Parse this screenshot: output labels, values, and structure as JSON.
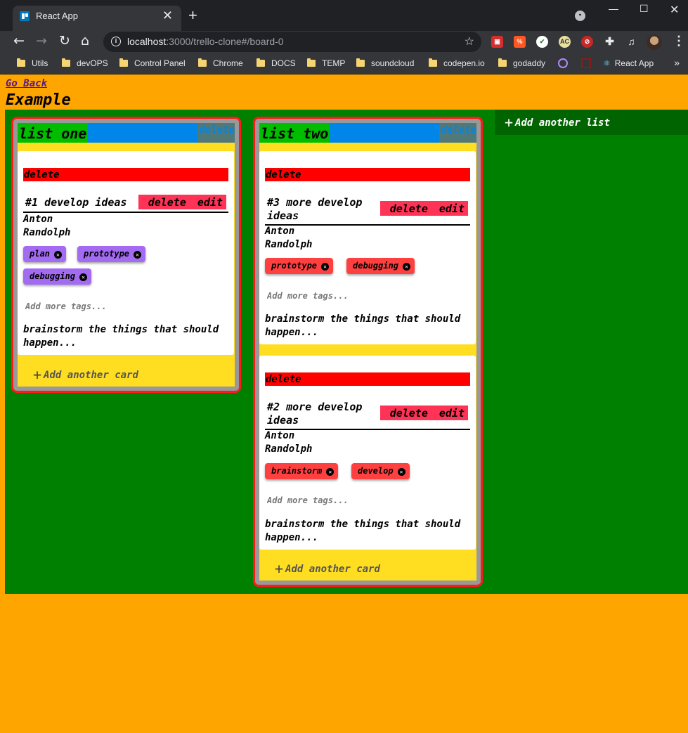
{
  "browser": {
    "tab_title": "React App",
    "tab_close": "✕",
    "new_tab": "+",
    "url_host": "localhost",
    "url_path": ":3000/trello-clone#/board-0",
    "bookmarks": [
      "Utils",
      "devOPS",
      "Control Panel",
      "Chrome",
      "DOCS",
      "TEMP",
      "soundcloud",
      "codepen.io",
      "godaddy",
      "React App"
    ],
    "bookmarks_more": "»",
    "extensions": [
      "shield-ext-icon",
      "code-ext-icon",
      "color-ext-icon",
      "ac-ext-icon",
      "blocker-ext-icon",
      "puzzle-icon",
      "media-icon"
    ],
    "ext_ac_label": "AC"
  },
  "app": {
    "go_back": "Go Back",
    "board_title": "Example",
    "add_list_label": "Add another list",
    "add_card_label": "Add another card",
    "tag_placeholder": "Add more tags...",
    "colors": {
      "background": "#ffa500",
      "board": "#008000",
      "list_border": "#ff1a1a",
      "list_body": "#ffde21",
      "card_delete": "#ff0000",
      "card_actions": "#ff3355",
      "tag_purple": "#a36bf2",
      "tag_red": "#ff4040"
    },
    "lists": [
      {
        "title": "list one",
        "delete_label": "delete",
        "cards": [
          {
            "delete_label": "delete",
            "name_line1": "#1 develop ideas",
            "name_line2": "",
            "actions_delete": "delete",
            "actions_edit": "edit",
            "owner_line1": "Anton",
            "owner_line2": "Randolph",
            "tags": [
              "plan",
              "prototype",
              "debugging"
            ],
            "description_line1": "brainstorm the things that should",
            "description_line2": "happen..."
          }
        ]
      },
      {
        "title": "list two",
        "delete_label": "delete",
        "cards": [
          {
            "delete_label": "delete",
            "name_line1": "#3 more develop",
            "name_line2": "ideas",
            "actions_delete": "delete",
            "actions_edit": "edit",
            "owner_line1": "Anton",
            "owner_line2": "Randolph",
            "tags": [
              "prototype",
              "debugging"
            ],
            "description_line1": "brainstorm the things that should",
            "description_line2": "happen..."
          },
          {
            "delete_label": "delete",
            "name_line1": "#2 more develop",
            "name_line2": "ideas",
            "actions_delete": "delete",
            "actions_edit": "edit",
            "owner_line1": "Anton",
            "owner_line2": "Randolph",
            "tags": [
              "brainstorm",
              "develop"
            ],
            "description_line1": "brainstorm the things that should",
            "description_line2": "happen..."
          }
        ]
      }
    ]
  }
}
